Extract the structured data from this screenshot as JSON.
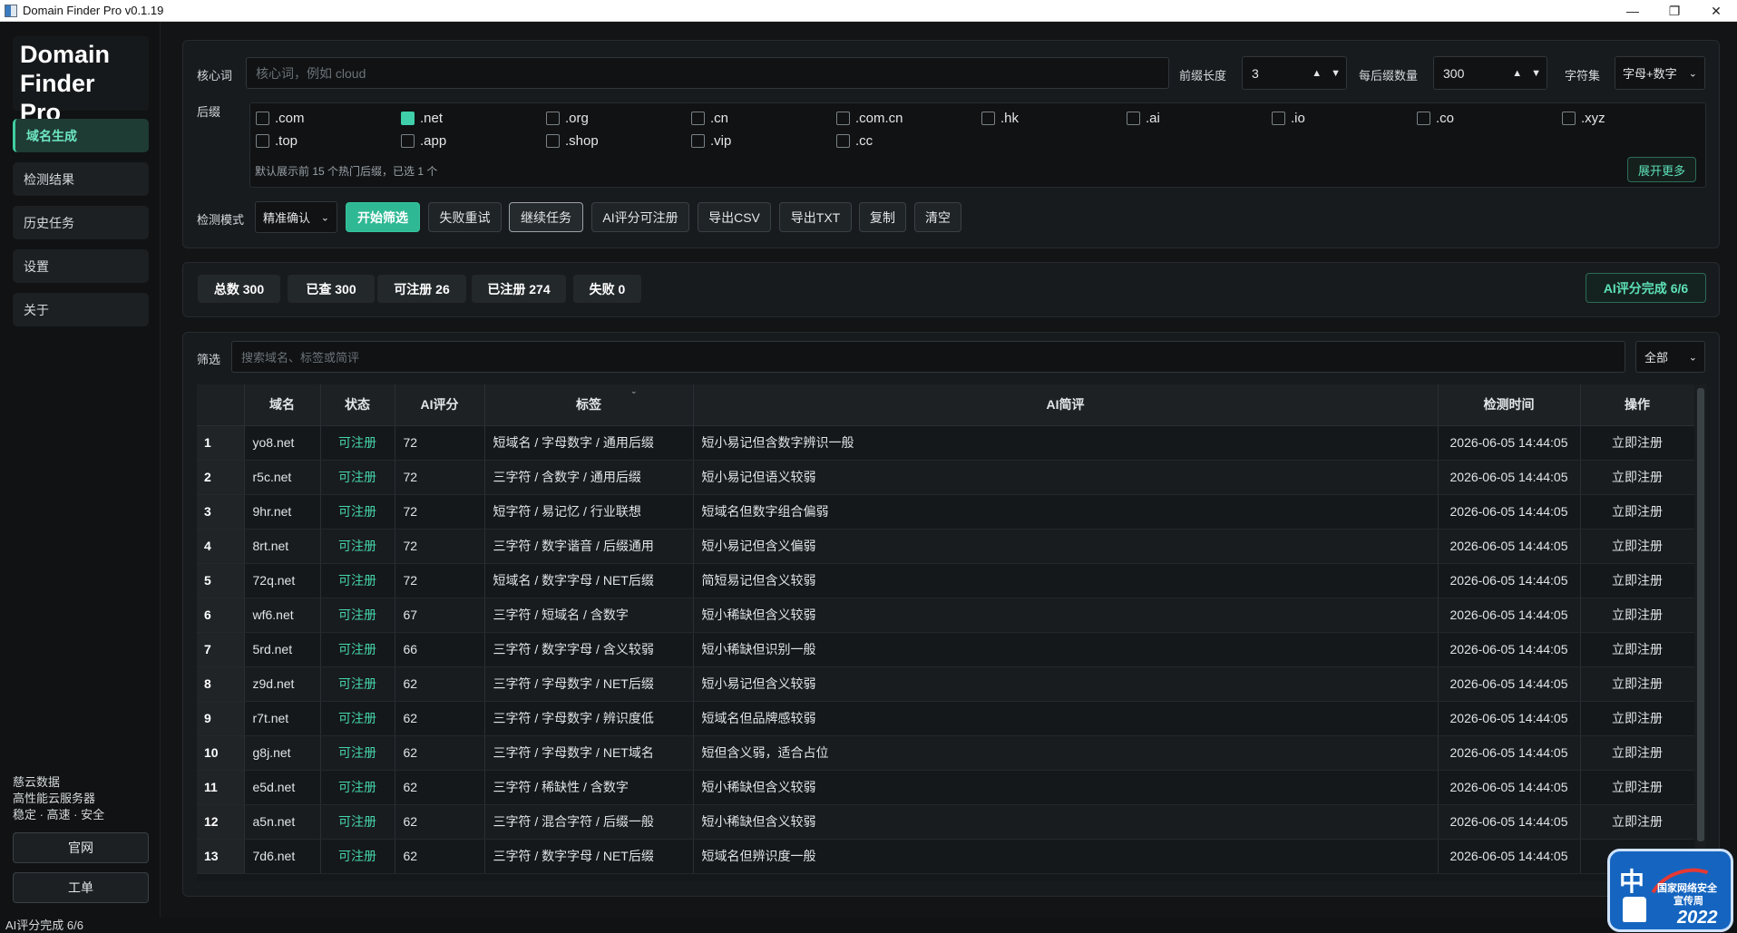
{
  "window": {
    "title": "Domain Finder Pro v0.1.19"
  },
  "sidebar": {
    "brand": "Domain Finder Pro",
    "items": [
      {
        "label": "域名生成",
        "active": true
      },
      {
        "label": "检测结果",
        "active": false
      },
      {
        "label": "历史任务",
        "active": false
      },
      {
        "label": "设置",
        "active": false
      },
      {
        "label": "关于",
        "active": false
      }
    ],
    "sponsor": {
      "line1": "慈云数据",
      "line2": "高性能云服务器",
      "line3": "稳定 · 高速 · 安全"
    },
    "website_button": "官网",
    "ticket_button": "工单"
  },
  "config": {
    "keyword_label": "核心词",
    "keyword_placeholder": "核心词，例如 cloud",
    "prefix_length_label": "前缀长度",
    "prefix_length_value": "3",
    "per_suffix_label": "每后缀数量",
    "per_suffix_value": "300",
    "charset_label": "字符集",
    "charset_value": "字母+数字",
    "suffix_label": "后缀",
    "suffixes": [
      {
        "label": ".com",
        "checked": false
      },
      {
        "label": ".net",
        "checked": true
      },
      {
        "label": ".org",
        "checked": false
      },
      {
        "label": ".cn",
        "checked": false
      },
      {
        "label": ".com.cn",
        "checked": false
      },
      {
        "label": ".hk",
        "checked": false
      },
      {
        "label": ".ai",
        "checked": false
      },
      {
        "label": ".io",
        "checked": false
      },
      {
        "label": ".co",
        "checked": false
      },
      {
        "label": ".xyz",
        "checked": false
      },
      {
        "label": ".top",
        "checked": false
      },
      {
        "label": ".app",
        "checked": false
      },
      {
        "label": ".shop",
        "checked": false
      },
      {
        "label": ".vip",
        "checked": false
      },
      {
        "label": ".cc",
        "checked": false
      }
    ],
    "suffix_hint": "默认展示前 15 个热门后缀，已选 1 个",
    "expand_more": "展开更多",
    "mode_label": "检测模式",
    "mode_value": "精准确认",
    "buttons": {
      "start": "开始筛选",
      "retry_failed": "失败重试",
      "continue_task": "继续任务",
      "ai_score": "AI评分可注册",
      "export_csv": "导出CSV",
      "export_txt": "导出TXT",
      "copy": "复制",
      "clear": "清空"
    }
  },
  "stats": {
    "total": "总数 300",
    "checked": "已查 300",
    "available": "可注册 26",
    "registered": "已注册 274",
    "failed": "失败 0",
    "ai_status": "AI评分完成 6/6"
  },
  "filter": {
    "label": "筛选",
    "placeholder": "搜索域名、标签或简评",
    "select_value": "全部"
  },
  "table": {
    "headers": [
      "",
      "域名",
      "状态",
      "AI评分",
      "标签",
      "AI简评",
      "检测时间",
      "操作"
    ],
    "rows": [
      {
        "no": "1",
        "domain": "yo8.net",
        "status": "可注册",
        "score": "72",
        "tags": "短域名 / 字母数字 / 通用后缀",
        "review": "短小易记但含数字辨识一般",
        "time": "2026-06-05 14:44:05",
        "action": "立即注册"
      },
      {
        "no": "2",
        "domain": "r5c.net",
        "status": "可注册",
        "score": "72",
        "tags": "三字符 / 含数字 / 通用后缀",
        "review": "短小易记但语义较弱",
        "time": "2026-06-05 14:44:05",
        "action": "立即注册"
      },
      {
        "no": "3",
        "domain": "9hr.net",
        "status": "可注册",
        "score": "72",
        "tags": "短字符 / 易记忆 / 行业联想",
        "review": "短域名但数字组合偏弱",
        "time": "2026-06-05 14:44:05",
        "action": "立即注册"
      },
      {
        "no": "4",
        "domain": "8rt.net",
        "status": "可注册",
        "score": "72",
        "tags": "三字符 / 数字谐音 / 后缀通用",
        "review": "短小易记但含义偏弱",
        "time": "2026-06-05 14:44:05",
        "action": "立即注册"
      },
      {
        "no": "5",
        "domain": "72q.net",
        "status": "可注册",
        "score": "72",
        "tags": "短域名 / 数字字母 / NET后缀",
        "review": "简短易记但含义较弱",
        "time": "2026-06-05 14:44:05",
        "action": "立即注册"
      },
      {
        "no": "6",
        "domain": "wf6.net",
        "status": "可注册",
        "score": "67",
        "tags": "三字符 / 短域名 / 含数字",
        "review": "短小稀缺但含义较弱",
        "time": "2026-06-05 14:44:05",
        "action": "立即注册"
      },
      {
        "no": "7",
        "domain": "5rd.net",
        "status": "可注册",
        "score": "66",
        "tags": "三字符 / 数字字母 / 含义较弱",
        "review": "短小稀缺但识别一般",
        "time": "2026-06-05 14:44:05",
        "action": "立即注册"
      },
      {
        "no": "8",
        "domain": "z9d.net",
        "status": "可注册",
        "score": "62",
        "tags": "三字符 / 字母数字 / NET后缀",
        "review": "短小易记但含义较弱",
        "time": "2026-06-05 14:44:05",
        "action": "立即注册"
      },
      {
        "no": "9",
        "domain": "r7t.net",
        "status": "可注册",
        "score": "62",
        "tags": "三字符 / 字母数字 / 辨识度低",
        "review": "短域名但品牌感较弱",
        "time": "2026-06-05 14:44:05",
        "action": "立即注册"
      },
      {
        "no": "10",
        "domain": "g8j.net",
        "status": "可注册",
        "score": "62",
        "tags": "三字符 / 字母数字 / NET域名",
        "review": "短但含义弱，适合占位",
        "time": "2026-06-05 14:44:05",
        "action": "立即注册"
      },
      {
        "no": "11",
        "domain": "e5d.net",
        "status": "可注册",
        "score": "62",
        "tags": "三字符 / 稀缺性 / 含数字",
        "review": "短小稀缺但含义较弱",
        "time": "2026-06-05 14:44:05",
        "action": "立即注册"
      },
      {
        "no": "12",
        "domain": "a5n.net",
        "status": "可注册",
        "score": "62",
        "tags": "三字符 / 混合字符 / 后缀一般",
        "review": "短小稀缺但含义较弱",
        "time": "2026-06-05 14:44:05",
        "action": "立即注册"
      },
      {
        "no": "13",
        "domain": "7d6.net",
        "status": "可注册",
        "score": "62",
        "tags": "三字符 / 数字字母 / NET后缀",
        "review": "短域名但辨识度一般",
        "time": "2026-06-05 14:44:05",
        "action": "立即注册"
      }
    ]
  },
  "status_bar": {
    "text": "AI评分完成 6/6"
  },
  "badge": {
    "zh": "中",
    "line1": "国家网络安全",
    "line2": "宣传周",
    "year": "2022"
  },
  "colors": {
    "accent": "#2fb894",
    "available": "#45d6ab",
    "background": "#121416",
    "panel": "#181b1e"
  }
}
